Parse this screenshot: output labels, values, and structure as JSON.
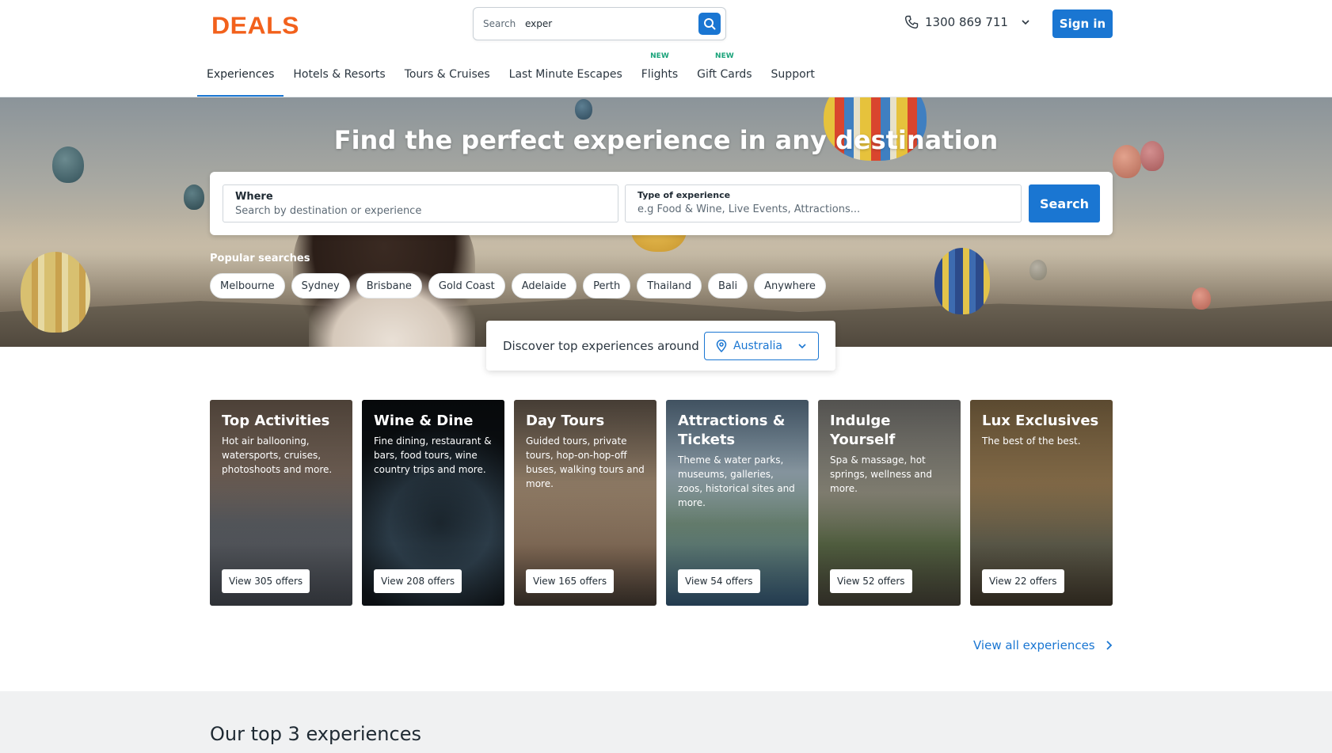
{
  "brand": {
    "logo": "DEALS",
    "accent": "#f2611c",
    "primary": "#1a76d2"
  },
  "header": {
    "search": {
      "label": "Search",
      "value": "exper"
    },
    "phone": "1300 869 711",
    "signin": "Sign in"
  },
  "nav": {
    "items": [
      {
        "label": "Experiences",
        "active": true,
        "badge": ""
      },
      {
        "label": "Hotels & Resorts",
        "badge": ""
      },
      {
        "label": "Tours & Cruises",
        "badge": ""
      },
      {
        "label": "Last Minute Escapes",
        "badge": ""
      },
      {
        "label": "Flights",
        "badge": "NEW"
      },
      {
        "label": "Gift Cards",
        "badge": "NEW"
      },
      {
        "label": "Support",
        "badge": ""
      }
    ]
  },
  "hero": {
    "title": "Find the perfect experience in any destination",
    "where": {
      "title": "Where",
      "placeholder": "Search by destination or experience"
    },
    "type": {
      "title": "Type of experience",
      "placeholder": "e.g Food & Wine, Live Events, Attractions..."
    },
    "search_button": "Search",
    "popular_label": "Popular searches",
    "popular": [
      "Melbourne",
      "Sydney",
      "Brisbane",
      "Gold Coast",
      "Adelaide",
      "Perth",
      "Thailand",
      "Bali",
      "Anywhere"
    ]
  },
  "discover": {
    "text": "Discover top experiences around",
    "country": "Australia"
  },
  "categories": [
    {
      "title": "Top Activities",
      "desc": "Hot air ballooning, watersports, cruises, photoshoots and more.",
      "cta": "View 305 offers"
    },
    {
      "title": "Wine & Dine",
      "desc": "Fine dining, restaurant & bars, food tours, wine country trips and more.",
      "cta": "View 208 offers"
    },
    {
      "title": "Day Tours",
      "desc": "Guided tours, private tours, hop-on-hop-off buses, walking tours and more.",
      "cta": "View 165 offers"
    },
    {
      "title": "Attractions & Tickets",
      "desc": "Theme & water parks, museums, galleries, zoos, historical sites and more.",
      "cta": "View 54 offers"
    },
    {
      "title": "Indulge Yourself",
      "desc": "Spa & massage, hot springs, wellness and more.",
      "cta": "View 52 offers"
    },
    {
      "title": "Lux Exclusives",
      "desc": "The best of the best.",
      "cta": "View 22 offers"
    }
  ],
  "view_all": "View all experiences",
  "section": {
    "title": "Our top 3 experiences"
  }
}
